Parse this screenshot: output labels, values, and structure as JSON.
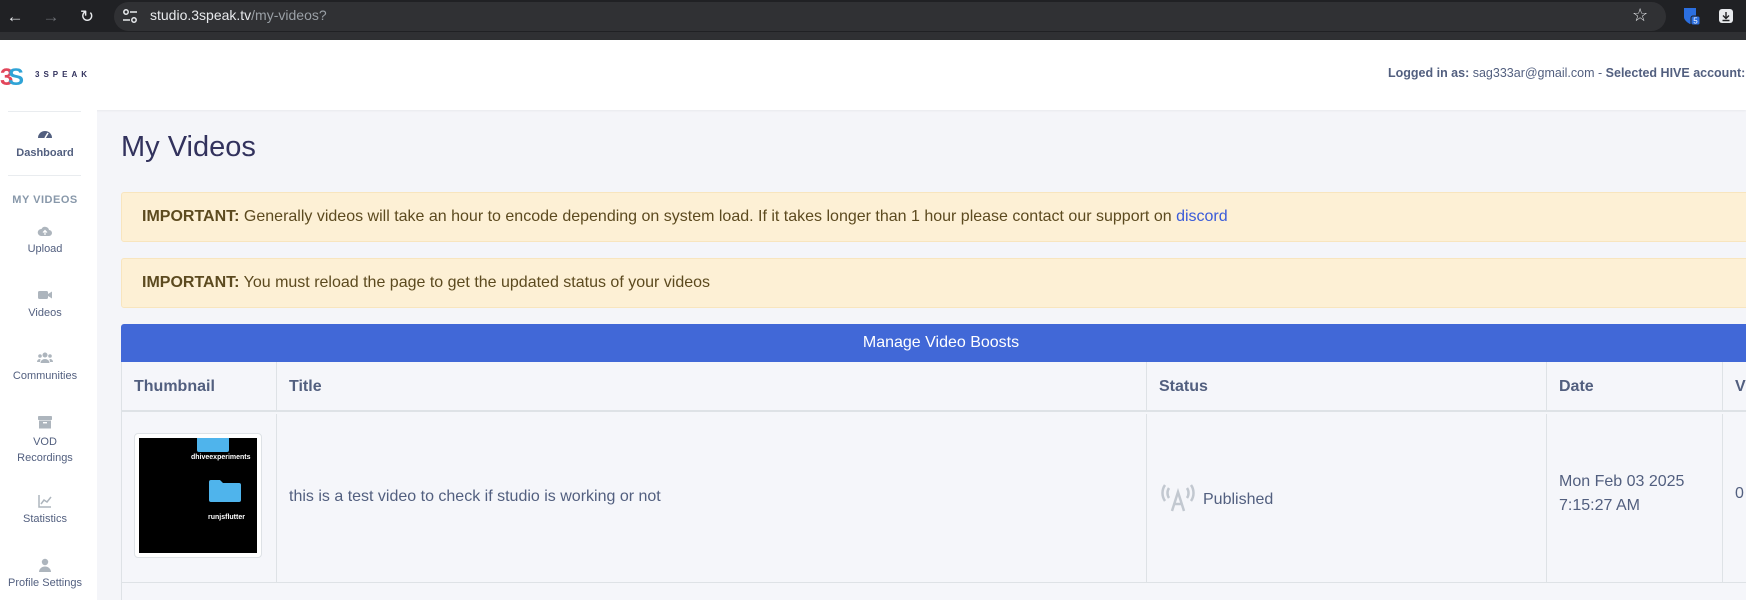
{
  "browser": {
    "url_host": "studio.3speak.tv",
    "url_path": "/my-videos?",
    "extension_badge": "5"
  },
  "header": {
    "brand": "3SPEAK",
    "logged_in_label": "Logged in as:",
    "logged_in_email": "sag333ar@gmail.com",
    "separator": "-",
    "hive_label": "Selected HIVE account:"
  },
  "sidebar": {
    "dashboard": "Dashboard",
    "section_title": "MY VIDEOS",
    "items": [
      {
        "label": "Upload",
        "icon": "cloud-upload-icon"
      },
      {
        "label": "Videos",
        "icon": "video-camera-icon"
      },
      {
        "label": "Communities",
        "icon": "users-icon"
      },
      {
        "label": "VOD Recordings",
        "icon": "archive-icon"
      },
      {
        "label": "Statistics",
        "icon": "chart-line-icon"
      },
      {
        "label": "Profile Settings",
        "icon": "user-icon"
      }
    ]
  },
  "main": {
    "title": "My Videos",
    "alerts": [
      {
        "label": "IMPORTANT:",
        "text": "Generally videos will take an hour to encode depending on system load. If it takes longer than 1 hour please contact our support on",
        "link": "discord"
      },
      {
        "label": "IMPORTANT:",
        "text": "You must reload the page to get the updated status of your videos"
      }
    ],
    "boost_button": "Manage Video Boosts",
    "table": {
      "headers": [
        "Thumbnail",
        "Title",
        "Status",
        "Date",
        "V"
      ],
      "rows": [
        {
          "thumbnail_folders": [
            "dhiveexperiments",
            "runjsflutter"
          ],
          "title": "this is a test video to check if studio is working or not",
          "status": "Published",
          "date_line1": "Mon Feb 03 2025",
          "date_line2": "7:15:27 AM",
          "views": "0"
        }
      ]
    }
  }
}
